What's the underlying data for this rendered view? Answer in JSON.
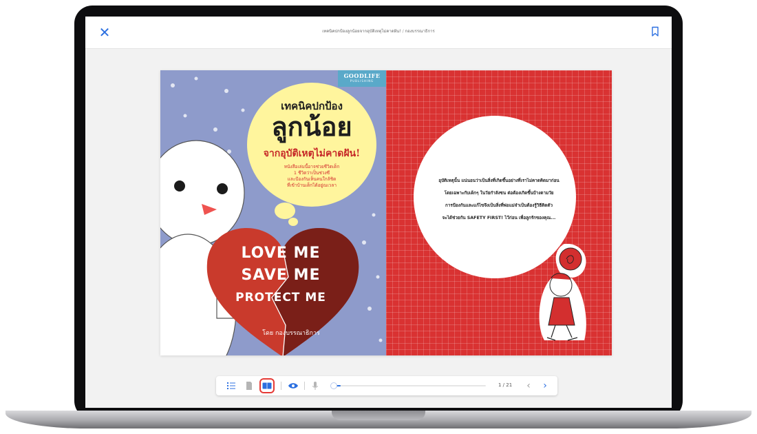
{
  "reader": {
    "title": "เทคนิคปกป้องลูกน้อยจากอุบัติเหตุไม่คาดฝัน!",
    "separator": " / ",
    "subtitle": "กองบรรณาธิการ"
  },
  "cover": {
    "publisher_line1": "GOODLIFE",
    "publisher_line2": "PUBLISHING",
    "title_line1": "เทคนิคปกป้อง",
    "title_line2": "ลูกน้อย",
    "title_line3": "จากอุบัติเหตุไม่คาดฝัน!",
    "subtitle_lines": [
      "หนังสือเล่มนี้อาจช่วยชีวิตเด็ก",
      "1 ชีวิตว่าเป็นช่วงซี",
      "และป้องกันเห็นคนใกล้ชิด",
      "ที่เข้าบ้านเด็กได้อยู่ณเวลา"
    ],
    "love_line1": "LOVE ME",
    "love_line2": "SAVE ME",
    "love_line3": "PROTECT ME",
    "author": "โดย กองบรรณาธิการ"
  },
  "back": {
    "blurb_lines": [
      "อุบัติเหตุนั้น แน่นอนว่าเป็นสิ่งที่เกิดขึ้นอย่างที่เราไม่คาดคิดมาก่อน",
      "โดยเฉพาะกับเด็กๆ ในวัยกำลังซน ต่อต้องเกิดขึ้นบ้างตามวัย",
      "การป้องกันและแก้ไขจึงเป็นสิ่งที่พ่อแม่จำเป็นต้องรู้วิธีติดตัว",
      "จะได้ช่วยกัน SAFETY FIRST! ไว้ก่อน เพื่อลูกรักของคุณ..."
    ]
  },
  "toolbar": {
    "page_indicator": "1 / 21",
    "progress": 0.0476
  },
  "colors": {
    "accent": "#2b6fe0",
    "active_outline": "#e53935",
    "cover_bg": "#8e9bcb",
    "back_bg": "#d93232",
    "bubble": "#fff59d"
  },
  "icons": [
    "close-icon",
    "bookmark-icon",
    "list-icon",
    "single-page-icon",
    "double-page-icon",
    "eye-icon",
    "microphone-icon",
    "chevron-left-icon",
    "chevron-right-icon"
  ]
}
